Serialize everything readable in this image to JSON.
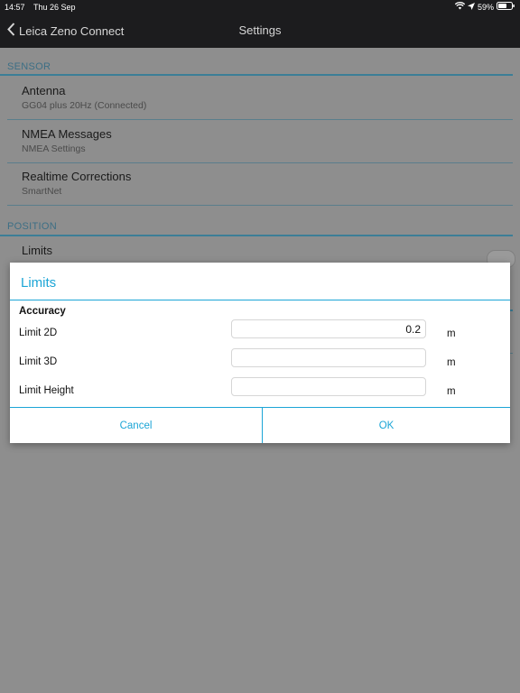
{
  "status_bar": {
    "time": "14:57",
    "date": "Thu 26 Sep",
    "battery": "59%"
  },
  "nav": {
    "back_label": "Leica Zeno Connect",
    "title": "Settings"
  },
  "sections": {
    "sensor": {
      "header": "SENSOR",
      "items": [
        {
          "label": "Antenna",
          "sub": "GG04 plus 20Hz (Connected)"
        },
        {
          "label": "NMEA Messages",
          "sub": "NMEA Settings"
        },
        {
          "label": "Realtime Corrections",
          "sub": "SmartNet"
        }
      ]
    },
    "position": {
      "header": "POSITION",
      "items": [
        {
          "label": "Limits"
        }
      ]
    }
  },
  "dialog": {
    "title": "Limits",
    "group": "Accuracy",
    "fields": [
      {
        "label": "Limit 2D",
        "value": "0.2",
        "unit": "m"
      },
      {
        "label": "Limit 3D",
        "value": "",
        "unit": "m"
      },
      {
        "label": "Limit Height",
        "value": "",
        "unit": "m"
      }
    ],
    "cancel_label": "Cancel",
    "ok_label": "OK"
  }
}
